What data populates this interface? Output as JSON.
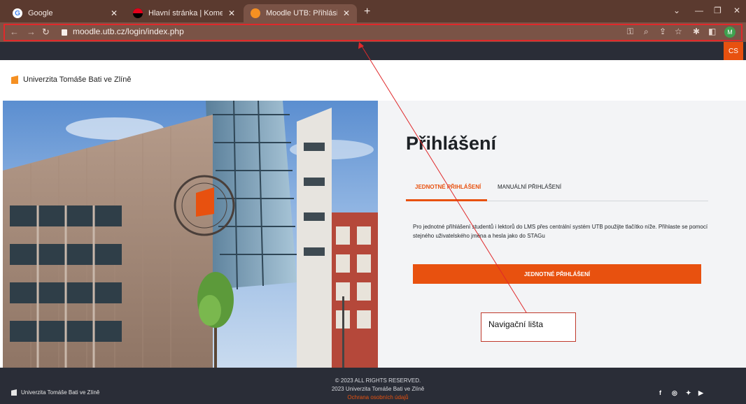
{
  "browser": {
    "tabs": [
      {
        "title": "Google",
        "active": false
      },
      {
        "title": "Hlavní stránka | Komerční banka",
        "active": false
      },
      {
        "title": "Moodle UTB: Přihlásit se na strán",
        "active": true
      }
    ],
    "new_tab": "+",
    "url": "moodle.utb.cz/login/index.php",
    "profile_initial": "M"
  },
  "site": {
    "lang": "CS",
    "brand": "Univerzita Tomáše Bati ve Zlíně"
  },
  "login": {
    "title": "Přihlášení",
    "tab_sso": "JEDNOTNÉ PŘIHLÁŠENÍ",
    "tab_manual": "MANUÁLNÍ PŘIHLÁŠENÍ",
    "description": "Pro jednotné přihlášení studentů i lektorů do LMS přes centrální systém UTB použijte tlačítko níže. Přihlaste se pomocí stejného uživatelského jména a hesla jako do STAGu",
    "sso_button": "JEDNOTNÉ PŘIHLÁŠENÍ"
  },
  "annotation": {
    "label": "Navigační lišta",
    "color": "#e0292b"
  },
  "footer": {
    "brand": "Univerzita Tomáše Bati ve Zlíně",
    "rights": "© 2023 ALL RIGHTS RESERVED.",
    "copyright": "2023 Univerzita Tomáše Bati ve Zlíně",
    "privacy": "Ochrana osobních údajů",
    "social": [
      "facebook-icon",
      "instagram-icon",
      "twitter-icon",
      "youtube-icon"
    ]
  },
  "colors": {
    "accent": "#e8510f",
    "chrome": "#5b3a2f",
    "dark": "#2a2d37"
  }
}
